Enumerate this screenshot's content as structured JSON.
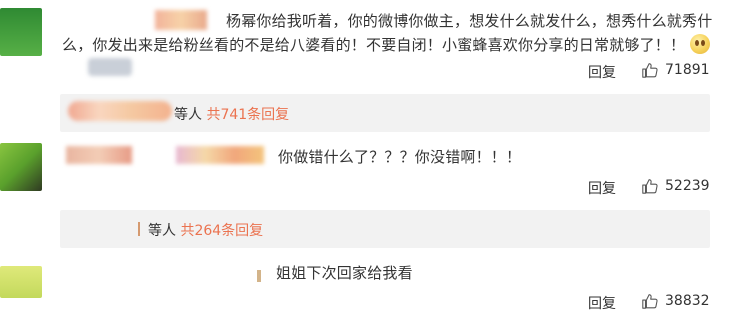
{
  "comments": [
    {
      "line1": "杨幂你给我听着，你的微博你做主，想发什么就发什么，想秀什么就秀什",
      "line2": "么，你发出来是给粉丝看的不是给八婆看的！不要自闭！小蜜蜂喜欢你分享的日常就够了！！",
      "reply_label": "回复",
      "likes": "71891",
      "summary": {
        "prefix": "等人",
        "count": "共741条回复"
      }
    },
    {
      "text": "你做错什么了？？？你没错啊！！！",
      "reply_label": "回复",
      "likes": "52239",
      "summary": {
        "prefix": "等人",
        "count": "共264条回复"
      }
    },
    {
      "text": "姐姐下次回家给我看",
      "reply_label": "回复",
      "likes": "38832"
    }
  ],
  "icons": {
    "like": "thumbs-up-icon",
    "emoji": "pleading-face-icon"
  },
  "colors": {
    "highlight": "#eb7350",
    "summary_bg": "#f2f2f2",
    "avatar_green": "#4c9a2a"
  }
}
